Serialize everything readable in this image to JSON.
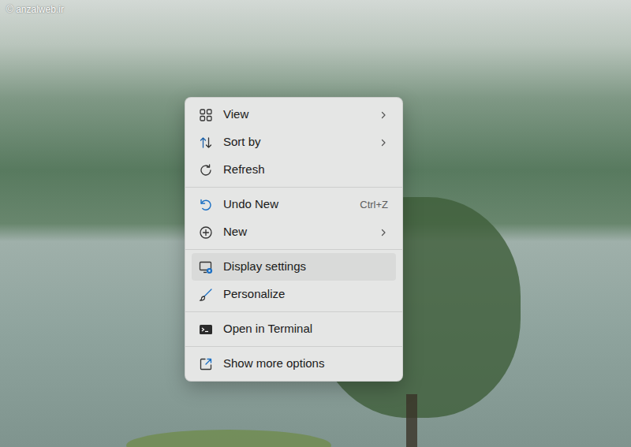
{
  "watermark": "© anzalweb.ir",
  "menu": {
    "groups": [
      [
        {
          "label": "View",
          "submenu": true,
          "selected": false
        },
        {
          "label": "Sort by",
          "submenu": true,
          "selected": false
        },
        {
          "label": "Refresh",
          "submenu": false,
          "selected": false
        }
      ],
      [
        {
          "label": "Undo New",
          "submenu": false,
          "selected": false,
          "shortcut": "Ctrl+Z"
        },
        {
          "label": "New",
          "submenu": true,
          "selected": false
        }
      ],
      [
        {
          "label": "Display settings",
          "submenu": false,
          "selected": true
        },
        {
          "label": "Personalize",
          "submenu": false,
          "selected": false
        }
      ],
      [
        {
          "label": "Open in Terminal",
          "submenu": false,
          "selected": false
        }
      ],
      [
        {
          "label": "Show more options",
          "submenu": false,
          "selected": false
        }
      ]
    ]
  }
}
